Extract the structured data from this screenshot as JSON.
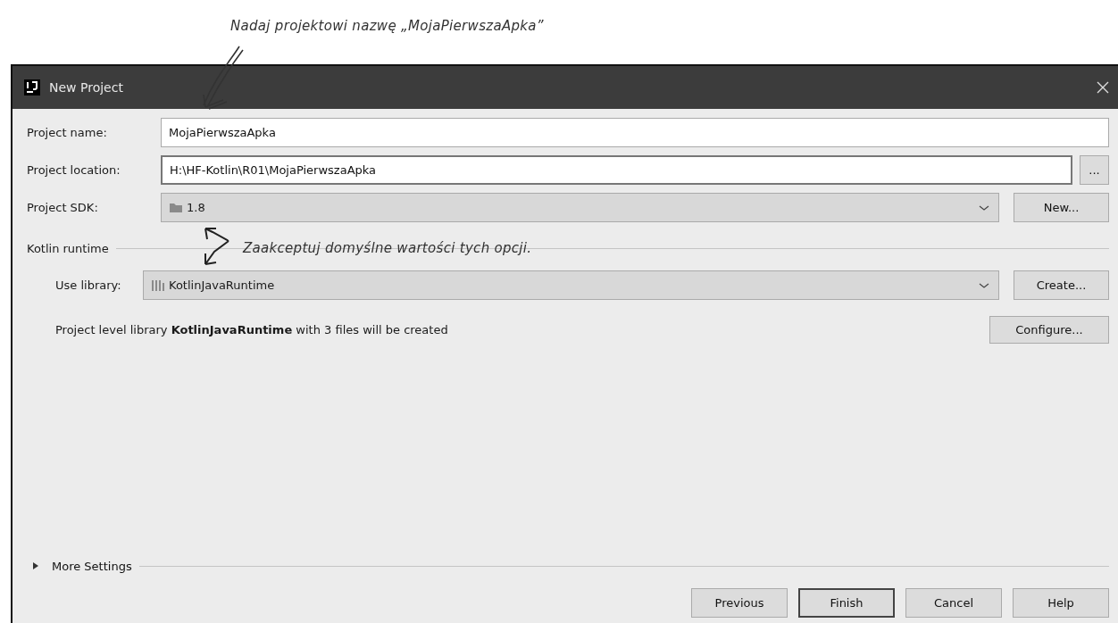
{
  "annotations": [
    {
      "text": "Nadaj projektowi nazwę „MojaPierwszaApka”"
    },
    {
      "text": "Zaakceptuj domyślne wartości tych opcji."
    }
  ],
  "window": {
    "title": "New Project"
  },
  "fields": [
    {
      "kind": "text",
      "label": "Project name:",
      "value": "MojaPierwszaApka"
    },
    {
      "kind": "text",
      "label": "Project location:",
      "value": "H:\\HF-Kotlin\\R01\\MojaPierwszaApka",
      "button": "..."
    },
    {
      "kind": "dropdown",
      "label": "Project SDK:",
      "value": "1.8",
      "button": "New..."
    }
  ],
  "kotlin_runtime": {
    "title": "Kotlin runtime",
    "library": {
      "label": "Use library:",
      "value": "KotlinJavaRuntime",
      "button": "Create..."
    },
    "info": "Project level library **KotlinJavaRuntime** with 3 files will be created",
    "configure_button": "Configure..."
  },
  "more_settings": {
    "label": "More Settings",
    "expanded": false
  },
  "buttons": [
    {
      "label": "Previous",
      "default": false
    },
    {
      "label": "Finish",
      "default": true
    },
    {
      "label": "Cancel",
      "default": false
    },
    {
      "label": "Help",
      "default": false
    }
  ]
}
